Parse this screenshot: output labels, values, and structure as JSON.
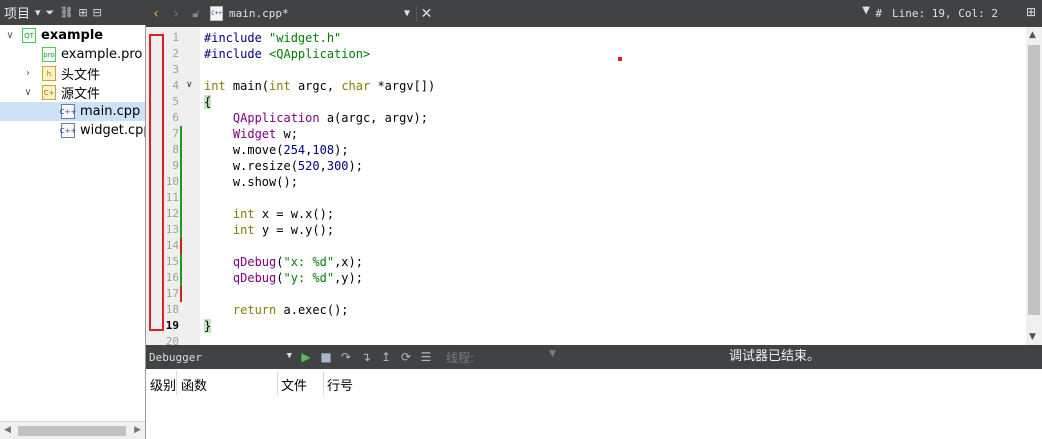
{
  "project_pane": {
    "title": "项目",
    "tree": [
      {
        "label": "example",
        "level": 0,
        "expanded": true,
        "kind": "project"
      },
      {
        "label": "example.pro",
        "level": 1,
        "kind": "pro"
      },
      {
        "label": "头文件",
        "level": 1,
        "expanded": false,
        "kind": "folder-h"
      },
      {
        "label": "源文件",
        "level": 1,
        "expanded": true,
        "kind": "folder-cpp"
      },
      {
        "label": "main.cpp",
        "level": 2,
        "kind": "cpp",
        "selected": true
      },
      {
        "label": "widget.cpp",
        "level": 2,
        "kind": "cpp"
      }
    ]
  },
  "editor": {
    "file_tab": "main.cpp*",
    "position_readout": "Line: 19, Col: 2",
    "line_numbers": [
      "1",
      "2",
      "3",
      "4",
      "5",
      "6",
      "7",
      "8",
      "9",
      "10",
      "11",
      "12",
      "13",
      "14",
      "15",
      "16",
      "17",
      "18",
      "19",
      "20"
    ],
    "current_line": 19
  },
  "code_lines": [
    "#include \"widget.h\"",
    "#include <QApplication>",
    "",
    "int main(int argc, char *argv[])",
    "{",
    "    QApplication a(argc, argv);",
    "    Widget w;",
    "    w.move(254,108);",
    "    w.resize(520,300);",
    "    w.show();",
    "",
    "    int x = w.x();",
    "    int y = w.y();",
    "",
    "    qDebug(\"x: %d\",x);",
    "    qDebug(\"y: %d\",y);",
    "",
    "    return a.exec();",
    "}",
    ""
  ],
  "debugger": {
    "label": "Debugger",
    "thread_label": "线程:",
    "status": "调试器已结束。",
    "columns": [
      "级别",
      "函数",
      "文件",
      "行号"
    ]
  },
  "colors": {
    "toolbar_bg": "#404244",
    "gutter_bg": "#efefef",
    "keyword": "#808000",
    "string": "#008000",
    "number": "#000080",
    "type": "#800080",
    "highlight_box": "#e0201f",
    "change_added": "#1c9a1c",
    "change_modified": "#d11e1e",
    "selection": "#cde1f7"
  }
}
